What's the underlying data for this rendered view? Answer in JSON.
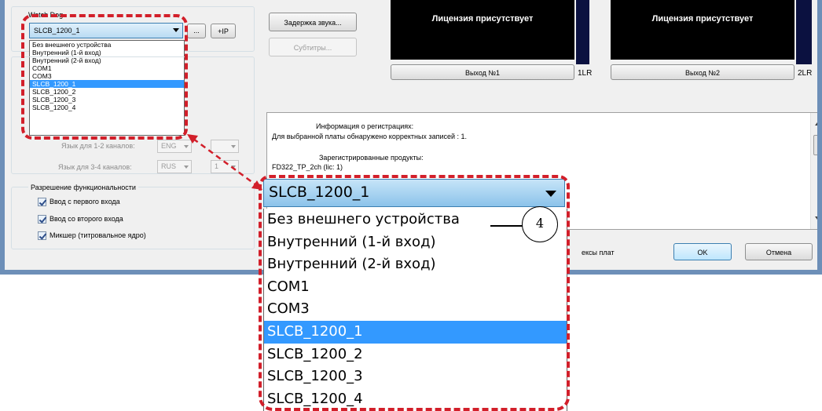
{
  "watchdog": {
    "label": "Watch Dog",
    "selected": "SLCB_1200_1",
    "browse_button": "...",
    "ip_button": "+IP",
    "options": [
      "Без внешнего устройства",
      "Внутренний (1-й вход)",
      "Внутренний (2-й вход)",
      "COM1",
      "COM3",
      "SLCB_1200_1",
      "SLCB_1200_2",
      "SLCB_1200_3",
      "SLCB_1200_4"
    ],
    "selected_index": 5
  },
  "language": {
    "label_12": "Язык для 1-2 каналов:",
    "value_12": "ENG",
    "label_34": "Язык для 3-4 каналов:",
    "value_34": "RUS",
    "count_34": "1"
  },
  "functionality": {
    "title": "Разрешение функциональности",
    "checks": [
      {
        "label": "Ввод с первого входа",
        "checked": true
      },
      {
        "label": "Ввод со второго входа",
        "checked": true
      },
      {
        "label": "Микшер (титровальное ядро)",
        "checked": true
      }
    ]
  },
  "buttons": {
    "sound_delay": "Задержка звука...",
    "subtitles": "Субтитры...",
    "ok": "OK",
    "cancel": "Отмена"
  },
  "outputs": [
    {
      "license": "Лицензия присутствует",
      "button": "Выход №1",
      "lr": "1LR"
    },
    {
      "license": "Лицензия присутствует",
      "button": "Выход №2",
      "lr": "2LR"
    }
  ],
  "info": {
    "title": "Информация о регистрациях:",
    "found": "Для выбранной платы обнаружено корректных записей : 1.",
    "products_title": "Зарегистрированные продукты:",
    "product": "FD322_TP_2ch (lic: 1)",
    "footer_fragment": "ексы плат"
  },
  "zoom": {
    "selected": "SLCB_1200_1",
    "options": [
      "Без внешнего устройства",
      "Внутренний (1-й вход)",
      "Внутренний (2-й вход)",
      "COM1",
      "COM3",
      "SLCB_1200_1",
      "SLCB_1200_2",
      "SLCB_1200_3",
      "SLCB_1200_4"
    ],
    "selected_index": 5,
    "callout": "4"
  },
  "colors": {
    "highlight": "#3399ff",
    "dash": "#d21f2a",
    "window_border": "#6d8fb8"
  }
}
